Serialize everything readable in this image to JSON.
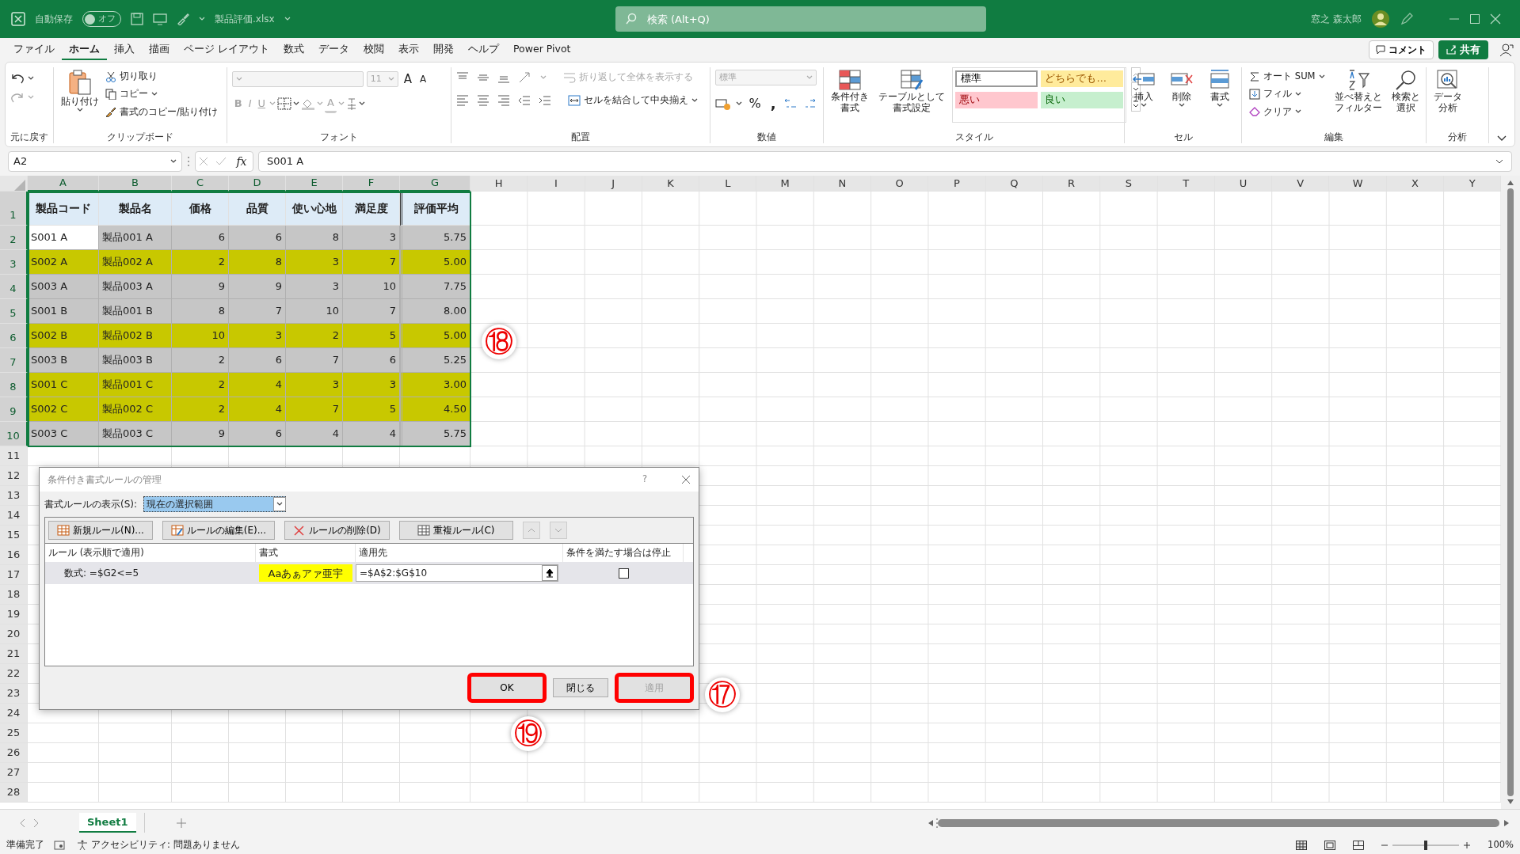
{
  "title_bar": {
    "autosave_label": "自動保存",
    "autosave": {
      "label": "オフ",
      "on": false
    },
    "filename": "製品評価.xlsx",
    "search_placeholder": "検索 (Alt+Q)",
    "user_name": "窓之 森太郎"
  },
  "menu_tabs": [
    {
      "label": "ファイル",
      "selected": false
    },
    {
      "label": "ホーム",
      "selected": true
    },
    {
      "label": "挿入",
      "selected": false
    },
    {
      "label": "描画",
      "selected": false
    },
    {
      "label": "ページ レイアウト",
      "selected": false
    },
    {
      "label": "数式",
      "selected": false
    },
    {
      "label": "データ",
      "selected": false
    },
    {
      "label": "校閲",
      "selected": false
    },
    {
      "label": "表示",
      "selected": false
    },
    {
      "label": "開発",
      "selected": false
    },
    {
      "label": "ヘルプ",
      "selected": false
    },
    {
      "label": "Power Pivot",
      "selected": false
    }
  ],
  "comment_button": "コメント",
  "share_button": "共有",
  "ribbon": {
    "undo": {
      "group_label": "元に戻す"
    },
    "clipboard": {
      "paste": "貼り付け",
      "cut": "切り取り",
      "copy": "コピー",
      "format_painter": "書式のコピー/貼り付け",
      "group_label": "クリップボード"
    },
    "font": {
      "font_size": "11",
      "grow": "A",
      "shrink": "A",
      "bold": "B",
      "italic": "I",
      "underline": "U",
      "font_color": "A",
      "group_label": "フォント"
    },
    "alignment": {
      "wrap_text": "折り返して全体を表示する",
      "merge_center": "セルを結合して中央揃え",
      "group_label": "配置"
    },
    "number": {
      "format": "標準",
      "percent": "%",
      "comma": ",",
      "group_label": "数値"
    },
    "styles": {
      "conditional": [
        "条件付き",
        "書式"
      ],
      "as_table": [
        "テーブルとして",
        "書式設定"
      ],
      "gallery": [
        {
          "label": "標準",
          "color": "#ffffff"
        },
        {
          "label": "どちらでも…",
          "color": "#ffeb9c"
        },
        {
          "label": "悪い",
          "color": "#ffc7ce"
        },
        {
          "label": "良い",
          "color": "#c6efce"
        }
      ],
      "group_label": "スタイル"
    },
    "cells": {
      "insert": "挿入",
      "delete": "削除",
      "format": "書式",
      "group_label": "セル"
    },
    "editing": {
      "autosum": "オート SUM",
      "fill": "フィル",
      "clear": "クリア",
      "sort": [
        "並べ替えと",
        "フィルター"
      ],
      "find": [
        "検索と",
        "選択"
      ],
      "group_label": "編集"
    },
    "analysis": {
      "button": [
        "データ",
        "分析"
      ],
      "group_label": "分析"
    }
  },
  "formula_bar": {
    "name_box": "A2",
    "fx": "fx",
    "formula": "S001 A"
  },
  "sheet": {
    "columns": [
      "A",
      "B",
      "C",
      "D",
      "E",
      "F",
      "G",
      "H",
      "I",
      "J",
      "K",
      "L",
      "M",
      "N",
      "O",
      "P",
      "Q",
      "R",
      "S",
      "T",
      "U",
      "V",
      "W",
      "X",
      "Y"
    ],
    "header_row": {
      "number": "1",
      "cells": [
        "製品コード",
        "製品名",
        "価格",
        "品質",
        "使い心地",
        "満足度",
        "評価平均"
      ]
    },
    "rows": [
      {
        "number": "2",
        "cells": [
          "S001 A",
          "製品001 A",
          "6",
          "6",
          "8",
          "3",
          "5.75"
        ],
        "highlighted": false,
        "active": true
      },
      {
        "number": "3",
        "cells": [
          "S002 A",
          "製品002 A",
          "2",
          "8",
          "3",
          "7",
          "5.00"
        ],
        "highlighted": true,
        "active": false
      },
      {
        "number": "4",
        "cells": [
          "S003 A",
          "製品003 A",
          "9",
          "9",
          "3",
          "10",
          "7.75"
        ],
        "highlighted": false,
        "active": false
      },
      {
        "number": "5",
        "cells": [
          "S001 B",
          "製品001 B",
          "8",
          "7",
          "10",
          "7",
          "8.00"
        ],
        "highlighted": false,
        "active": false
      },
      {
        "number": "6",
        "cells": [
          "S002 B",
          "製品002 B",
          "10",
          "3",
          "2",
          "5",
          "5.00"
        ],
        "highlighted": true,
        "active": false
      },
      {
        "number": "7",
        "cells": [
          "S003 B",
          "製品003 B",
          "2",
          "6",
          "7",
          "6",
          "5.25"
        ],
        "highlighted": false,
        "active": false
      },
      {
        "number": "8",
        "cells": [
          "S001 C",
          "製品001 C",
          "2",
          "4",
          "3",
          "3",
          "3.00"
        ],
        "highlighted": true,
        "active": false
      },
      {
        "number": "9",
        "cells": [
          "S002 C",
          "製品002 C",
          "2",
          "4",
          "7",
          "5",
          "4.50"
        ],
        "highlighted": true,
        "active": false
      },
      {
        "number": "10",
        "cells": [
          "S003 C",
          "製品003 C",
          "9",
          "6",
          "4",
          "4",
          "5.75"
        ],
        "highlighted": false,
        "active": false
      }
    ],
    "empty_rows": [
      "11",
      "12",
      "13",
      "14",
      "15",
      "16",
      "17",
      "18",
      "19",
      "20",
      "21",
      "22",
      "23",
      "24",
      "25",
      "26",
      "27",
      "28"
    ]
  },
  "dialog": {
    "title": "条件付き書式ルールの管理",
    "help": "?",
    "show_label": "書式ルールの表示(S):",
    "show_value": "現在の選択範囲",
    "toolbar": [
      "新規ルール(N)...",
      "ルールの編集(E)...",
      "ルールの削除(D)",
      "重複ルール(C)"
    ],
    "columns": [
      "ルール (表示順で適用)",
      "書式",
      "適用先",
      "条件を満たす場合は停止"
    ],
    "rules": [
      {
        "rule": "数式: =$G2<=5",
        "preview": "Aaあぁアァ亜宇",
        "applies_to": "=$A$2:$G$10",
        "stop_if_true": false,
        "selected": true
      }
    ],
    "buttons": [
      {
        "label": "OK",
        "kind": "default",
        "highlighted": true
      },
      {
        "label": "閉じる",
        "kind": "normal",
        "highlighted": false
      },
      {
        "label": "適用",
        "kind": "disabled",
        "highlighted": true
      }
    ]
  },
  "callouts": [
    {
      "label": "⑱"
    },
    {
      "label": "⑰"
    },
    {
      "label": "⑲"
    }
  ],
  "sheet_tabs": [
    {
      "label": "Sheet1",
      "selected": true
    }
  ],
  "status_bar": {
    "ready": "準備完了",
    "accessibility": "アクセシビリティ: 問題ありません",
    "zoom_slider": {
      "level": 0.5
    },
    "zoom": "100%"
  }
}
